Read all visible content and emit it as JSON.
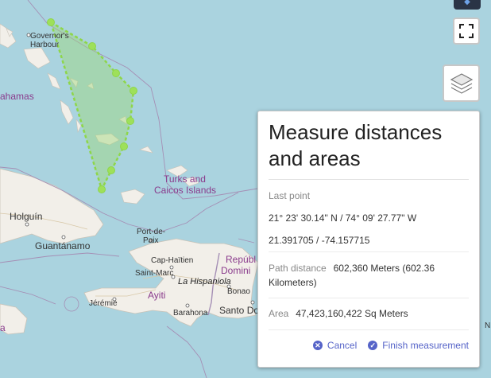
{
  "map": {
    "labels": {
      "governors_harbour_1": "Governor's",
      "governors_harbour_2": "Harbour",
      "bahamas": "ahamas",
      "turks_1": "Turks and",
      "turks_2": "Caicos Islands",
      "holguin": "Holguín",
      "guantanamo": "Guantánamo",
      "port_de_paix_1": "Port-de-",
      "port_de_paix_2": "Paix",
      "cap_haitien": "Cap-Haïtien",
      "republica_1": "Repúbl",
      "republica_2": "Domini",
      "saint_marc": "Saint-Marc",
      "la_hispaniola": "La Hispaniola",
      "bonao": "Bonao",
      "ayiti": "Ayiti",
      "jeremie": "Jérémie",
      "barahona": "Barahona",
      "santo_domingo": "Santo Do",
      "edge_n": "N",
      "edge_a": "a"
    },
    "colors": {
      "water": "#aad3df",
      "land": "#f2efe9",
      "border": "#a58fb5",
      "polygon_fill": "#9ed67a",
      "polygon_stroke": "#8ed64a"
    }
  },
  "controls": {
    "fullscreen_icon": "fullscreen-icon",
    "layers_icon": "layers-icon"
  },
  "measure": {
    "title": "Measure distances and areas",
    "last_point_label": "Last point",
    "last_point_dms": "21° 23' 30.14\" N / 74° 09' 27.77\" W",
    "last_point_decimal": "21.391705 / -74.157715",
    "path_distance_label": "Path distance",
    "path_distance_value": "602,360 Meters (602.36 Kilometers)",
    "area_label": "Area",
    "area_value": "47,423,160,422 Sq Meters",
    "cancel_label": "Cancel",
    "finish_label": "Finish measurement"
  }
}
